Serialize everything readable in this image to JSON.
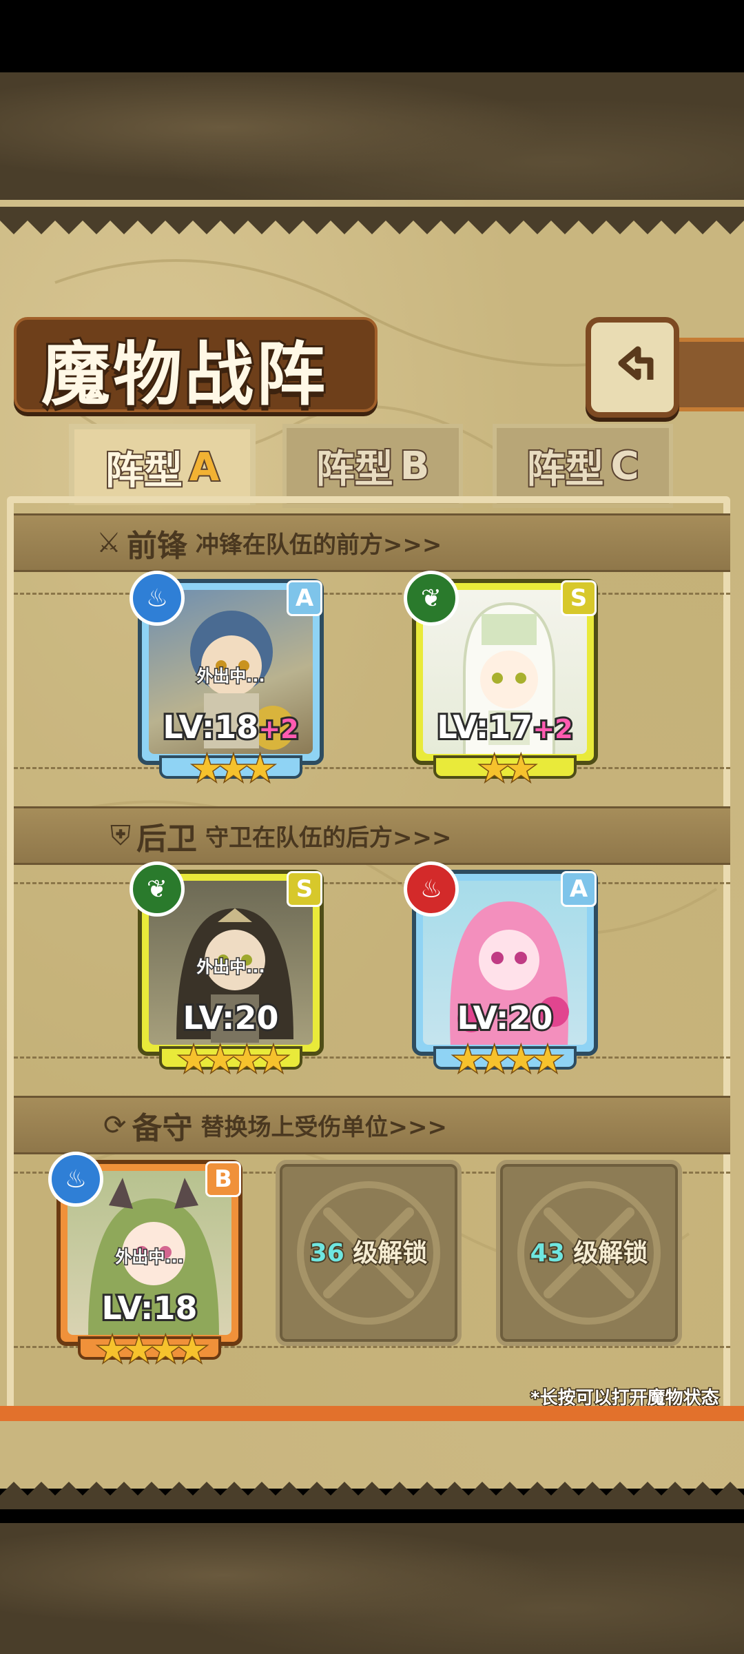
{
  "title": "魔物战阵",
  "tabs": [
    {
      "label_main": "阵型",
      "label_letter": "A",
      "active": true
    },
    {
      "label_main": "阵型",
      "label_letter": "B",
      "active": false
    },
    {
      "label_main": "阵型",
      "label_letter": "C",
      "active": false
    }
  ],
  "sections": {
    "front": {
      "title": "前锋",
      "subtitle": "冲锋在队伍的前方>>>",
      "icon": "sword-icon"
    },
    "rear": {
      "title": "后卫",
      "subtitle": "守卫在队伍的后方>>>",
      "icon": "shield-icon"
    },
    "reserve": {
      "title": "备守",
      "subtitle": "替换场上受伤单位>>>",
      "icon": "swap-icon"
    }
  },
  "monsters": {
    "front1": {
      "element": "water",
      "element_icon": "water-icon",
      "rank": "A",
      "status": "外出中...",
      "level": "LV:18",
      "bonus": "+2",
      "stars": "★★★",
      "star_count": 3,
      "frame_color": "#8fd3f4"
    },
    "front2": {
      "element": "grass",
      "element_icon": "leaf-icon",
      "rank": "S",
      "status": "",
      "level": "LV:17",
      "bonus": "+2",
      "stars": "★★",
      "star_count": 2,
      "frame_color": "#e9ea3a"
    },
    "rear1": {
      "element": "grass",
      "element_icon": "leaf-icon",
      "rank": "S",
      "status": "外出中...",
      "level": "LV:20",
      "bonus": "",
      "stars": "★★★★",
      "star_count": 4,
      "frame_color": "#e9ea3a"
    },
    "rear2": {
      "element": "fire",
      "element_icon": "flame-icon",
      "rank": "A",
      "status": "",
      "level": "LV:20",
      "bonus": "",
      "stars": "★★★★",
      "star_count": 4,
      "frame_color": "#8fd3f4"
    },
    "reserve1": {
      "element": "water",
      "element_icon": "water-icon",
      "rank": "B",
      "status": "外出中...",
      "level": "LV:18",
      "bonus": "",
      "stars": "★★★★",
      "star_count": 4,
      "frame_color": "#f0913a"
    }
  },
  "locked_slots": [
    {
      "level": "36",
      "label": "级解锁"
    },
    {
      "level": "43",
      "label": "级解锁"
    }
  ],
  "footer_note": "*长按可以打开魔物状态",
  "colors": {
    "parchment": "#c9b67f",
    "frame_brown": "#6e3f1a",
    "accent_orange": "#e2712c",
    "star": "#f6c22d",
    "bonus_pink": "#ff5bb1",
    "unlock_cyan": "#6fe6e0"
  }
}
